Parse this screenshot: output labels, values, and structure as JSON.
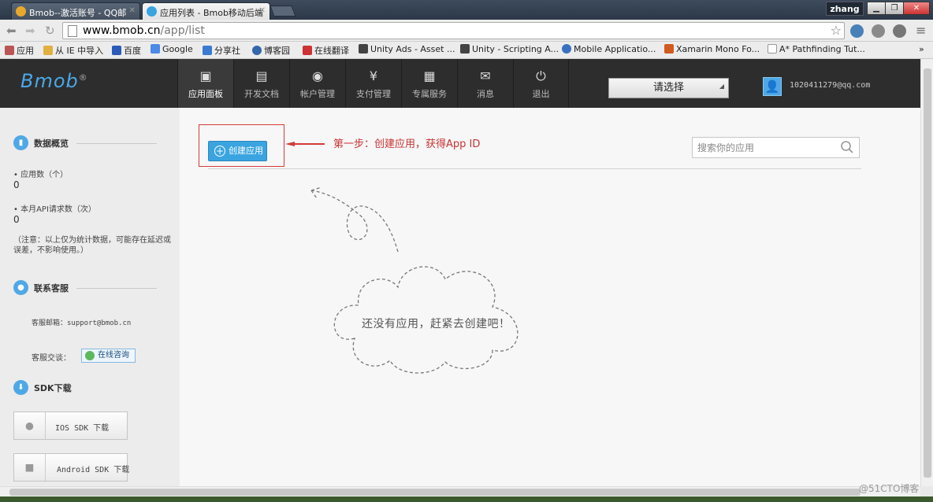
{
  "browser": {
    "tabs": [
      {
        "title": "Bmob--激活账号 - QQ邮",
        "active": false
      },
      {
        "title": "应用列表 - Bmob移动后端",
        "active": true
      }
    ],
    "user_badge": "zhang",
    "url_host": "www.bmob.cn",
    "url_path": "/app/list",
    "bookmarks": [
      "应用",
      "从 IE 中导入",
      "百度",
      "Google",
      "分享社",
      "博客园",
      "在线翻译",
      "Unity Ads - Asset ...",
      "Unity - Scripting A...",
      "Mobile Applicatio...",
      "Xamarin Mono Fo...",
      "A* Pathfinding Tut..."
    ],
    "bookmarks_overflow": "»"
  },
  "header": {
    "logo": "Bmob",
    "logo_mark": "®",
    "nav": [
      "应用面板",
      "开发文档",
      "帐户管理",
      "支付管理",
      "专属服务",
      "消息",
      "退出"
    ],
    "select_label": "请选择",
    "user_email": "1020411279@qq.com"
  },
  "sidebar": {
    "stats_title": "数据概览",
    "app_count_label": "应用数（个）",
    "app_count": "0",
    "api_label": "本月API请求数（次）",
    "api_count": "0",
    "note": "（注意：以上仅为统计数据，可能存在延迟或误差，不影响使用。）",
    "contact_title": "联系客服",
    "email_label": "客服邮箱：support@bmob.cn",
    "chat_label": "客服交谈：",
    "chat_button": "在线咨询",
    "sdk_title": "SDK下载",
    "ios_sdk": "IOS SDK 下载",
    "android_sdk": "Android SDK 下载"
  },
  "main": {
    "create_button": "创建应用",
    "annotation": "第一步：创建应用，获得App ID",
    "search_placeholder": "搜索你的应用",
    "empty_message": "还没有应用，赶紧去创建吧！"
  },
  "watermark": "@51CTO博客",
  "colors": {
    "accent": "#3aa4e0",
    "header_bg": "#2d2d2d",
    "annotation": "#d63a3a"
  }
}
